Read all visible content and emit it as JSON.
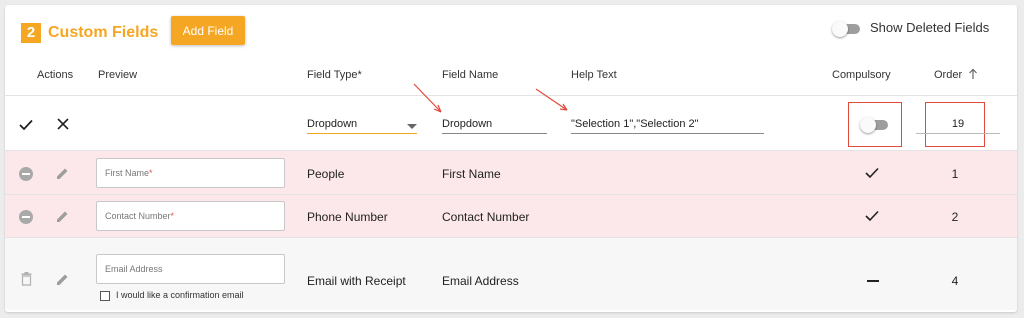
{
  "header": {
    "step_number": "2",
    "title": "Custom Fields",
    "add_button_label": "Add Field",
    "show_deleted_label": "Show Deleted Fields"
  },
  "columns": {
    "actions": "Actions",
    "preview": "Preview",
    "field_type": "Field Type*",
    "field_name": "Field Name",
    "help_text": "Help Text",
    "compulsory": "Compulsory",
    "order": "Order"
  },
  "edit_row": {
    "field_type_value": "Dropdown",
    "field_name_value": "Dropdown",
    "help_text_value": "\"Selection 1\",\"Selection 2\"",
    "order_value": "19"
  },
  "rows": [
    {
      "preview_label": "First Name",
      "required_mark": "*",
      "field_type": "People",
      "field_name": "First Name",
      "compulsory": true,
      "order": "1"
    },
    {
      "preview_label": "Contact Number",
      "required_mark": "*",
      "field_type": "Phone Number",
      "field_name": "Contact Number",
      "compulsory": true,
      "order": "2"
    },
    {
      "preview_label": "Email Address",
      "checkbox_label": "I would like a confirmation email",
      "field_type": "Email with Receipt",
      "field_name": "Email Address",
      "compulsory": false,
      "order": "4"
    }
  ],
  "colors": {
    "accent": "#f5a623",
    "deleted_row_bg": "#fce8ea",
    "annotation_red": "#e04a3a"
  },
  "icons": [
    "check-icon",
    "close-icon",
    "remove-circle-icon",
    "pencil-icon",
    "trash-icon",
    "checkmark-icon",
    "dash-icon",
    "sort-arrow-up-icon"
  ]
}
